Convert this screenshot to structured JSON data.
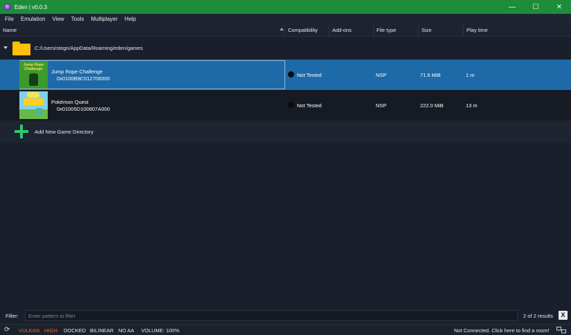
{
  "window": {
    "title": "Eden | v0.0.3",
    "controls": {
      "minimize": "—",
      "maximize": "☐",
      "close": "✕"
    }
  },
  "menu": {
    "items": [
      "File",
      "Emulation",
      "View",
      "Tools",
      "Multiplayer",
      "Help"
    ]
  },
  "columns": [
    "Name",
    "Compatibility",
    "Add-ons",
    "File type",
    "Size",
    "Play time"
  ],
  "directory": {
    "path": "C:/Users/stegn/AppData/Roaming/eden/games"
  },
  "games": [
    {
      "thumbnail_title": "Jump Rope Challenge",
      "name": "Jump Rope Challenge",
      "id": "0x0100B9C012706000",
      "compatibility": "Not Tested",
      "file_type": "NSP",
      "size": "71.6 MiB",
      "play_time": "1 m",
      "selected": true
    },
    {
      "name": "Pokémon Quest",
      "id": "0x01005D100807A000",
      "compatibility": "Not Tested",
      "file_type": "NSP",
      "size": "222.0 MiB",
      "play_time": "13 m",
      "selected": false
    }
  ],
  "add_directory": {
    "label": "Add New Game Directory",
    "icon": "plus-icon"
  },
  "filter": {
    "label": "Filter:",
    "placeholder": "Enter pattern to filter",
    "results": "2 of 2 results",
    "clear_label": "X"
  },
  "status": {
    "api": "VULKAN",
    "accuracy": "HIGH",
    "dock": "DOCKED",
    "filter": "BILINEAR",
    "aa": "NO AA",
    "volume": "VOLUME: 100%",
    "network": "Not Connected. Click here to find a room!",
    "accent_color": "#e4662d"
  },
  "colors": {
    "titlebar": "#1e8d3b",
    "selection": "#1e6aa8",
    "background": "#1a202b",
    "folder": "#ffc107",
    "add_icon": "#2ecc71"
  }
}
